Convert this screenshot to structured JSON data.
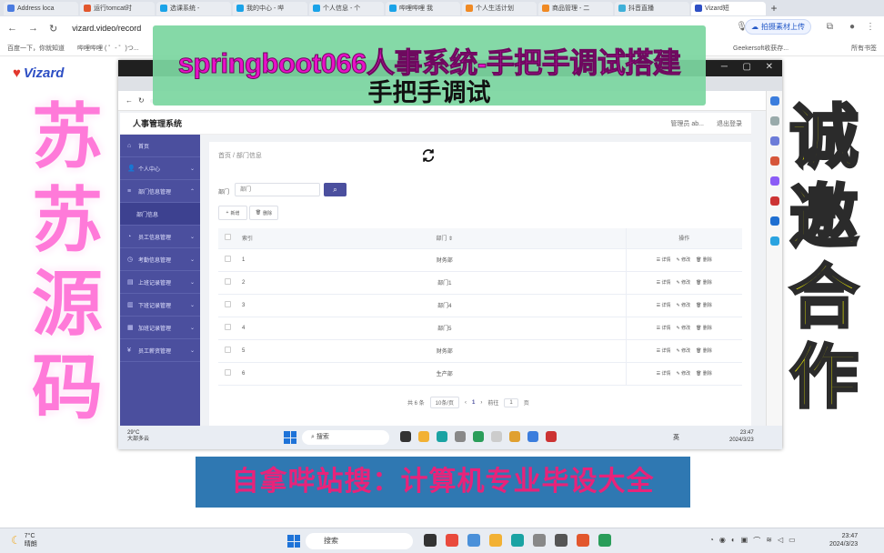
{
  "browser": {
    "tabs": [
      "Address loca",
      "运行tomcat时",
      "选课系统 - ",
      "我的中心 - 哔",
      "个人信息 - 个",
      "哔哩哔哩 我",
      "个人生活计划",
      "商品管理 - 二",
      "抖音直播",
      "Vizard短"
    ],
    "url": "vizard.video/record",
    "upload_button": "拍摄素材上传",
    "bookmarks": [
      "百度一下，你就知道",
      "哔哩哔哩 ( ゜- ゜)つ...",
      "Geekersoft收获存...",
      "所有书签"
    ],
    "logo": "Vizard"
  },
  "inner_window": {
    "app_title": "人事管理系统",
    "user": "管理员 ab...",
    "logout": "退出登录",
    "breadcrumb": "首页 / 部门信息",
    "sidebar": [
      "首页",
      "个人中心",
      "部门信息管理",
      "部门信息",
      "员工信息管理",
      "考勤信息管理",
      "上班记录管理",
      "下班记录管理",
      "加班记录管理",
      "员工薪资管理"
    ],
    "filter_label": "部门",
    "filter_placeholder": "部门",
    "search_icon": "search-icon",
    "add_label": "新增",
    "delete_label": "删除",
    "columns": [
      "索引",
      "部门 ⇕",
      "操作"
    ],
    "row_actions": [
      "详情",
      "修改",
      "删除"
    ],
    "rows": [
      {
        "idx": "1",
        "name": "财务部"
      },
      {
        "idx": "2",
        "name": "部门1"
      },
      {
        "idx": "3",
        "name": "部门4"
      },
      {
        "idx": "4",
        "name": "部门5"
      },
      {
        "idx": "5",
        "name": "财务部"
      },
      {
        "idx": "6",
        "name": "生产部"
      }
    ],
    "pager": {
      "total": "共 6 条",
      "size": "10条/页",
      "prev": "‹",
      "page": "1",
      "next": "›",
      "goto": "前往",
      "goto_page": "1",
      "page_unit": "页"
    },
    "taskbar": {
      "weather_temp": "29°C",
      "weather_text": "大部多云",
      "search": "搜索",
      "lang": "英",
      "time": "23:47",
      "date": "2024/3/23"
    }
  },
  "overlay": {
    "title_line1": "springboot066人事系统-手把手调试搭建",
    "title_line2": "手把手调试",
    "left_text": "苏苏源码",
    "right_text": "诚邀合作",
    "bottom_text": "自拿哔站搜：计算机专业毕设大全"
  },
  "taskbar": {
    "weather_temp": "7°C",
    "weather_text": "晴朗",
    "search": "搜索",
    "time": "23:47",
    "date": "2024/3/23"
  }
}
